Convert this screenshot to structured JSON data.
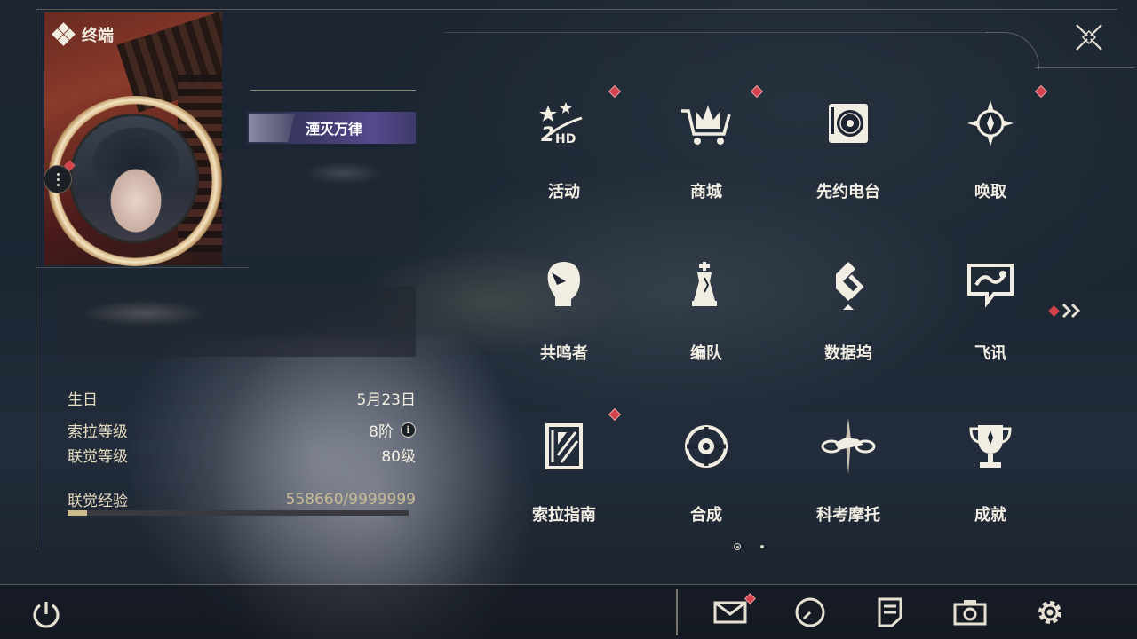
{
  "header": {
    "title": "终端",
    "icon": "diamond-cluster-icon"
  },
  "profile": {
    "title_badge": "湮灭万律",
    "stats": [
      {
        "label": "生日",
        "value": "5月23日"
      },
      {
        "label": "索拉等级",
        "value": "8阶"
      },
      {
        "label": "联觉等级",
        "value": "80级"
      }
    ],
    "exp": {
      "label": "联觉经验",
      "value": "558660/9999999",
      "progress": 0.056
    }
  },
  "menu": {
    "page": 1,
    "page_count": 2,
    "items": [
      {
        "label": "活动",
        "icon": "event-2hd-icon",
        "badge": true
      },
      {
        "label": "商城",
        "icon": "shop-cart-crown-icon",
        "badge": true
      },
      {
        "label": "先约电台",
        "icon": "radio-record-icon",
        "badge": false
      },
      {
        "label": "唤取",
        "icon": "summon-compass-icon",
        "badge": true
      },
      {
        "label": "共鸣者",
        "icon": "resonator-head-icon",
        "badge": false
      },
      {
        "label": "编队",
        "icon": "team-chess-icon",
        "badge": false
      },
      {
        "label": "数据坞",
        "icon": "data-dock-icon",
        "badge": false
      },
      {
        "label": "飞讯",
        "icon": "chat-message-icon",
        "badge": false
      },
      {
        "label": "索拉指南",
        "icon": "guide-book-icon",
        "badge": true
      },
      {
        "label": "合成",
        "icon": "synthesis-orb-icon",
        "badge": false
      },
      {
        "label": "科考摩托",
        "icon": "motorbike-icon",
        "badge": false
      },
      {
        "label": "成就",
        "icon": "trophy-icon",
        "badge": false
      }
    ]
  },
  "bottom_bar": [
    {
      "icon": "mail-icon",
      "badge": true
    },
    {
      "icon": "clock-icon",
      "badge": false
    },
    {
      "icon": "notes-icon",
      "badge": false
    },
    {
      "icon": "camera-icon",
      "badge": false
    },
    {
      "icon": "settings-gear-icon",
      "badge": false
    }
  ],
  "colors": {
    "accent_red": "#d4424c",
    "gold": "#cdbb8c",
    "text": "#f2ede2"
  }
}
